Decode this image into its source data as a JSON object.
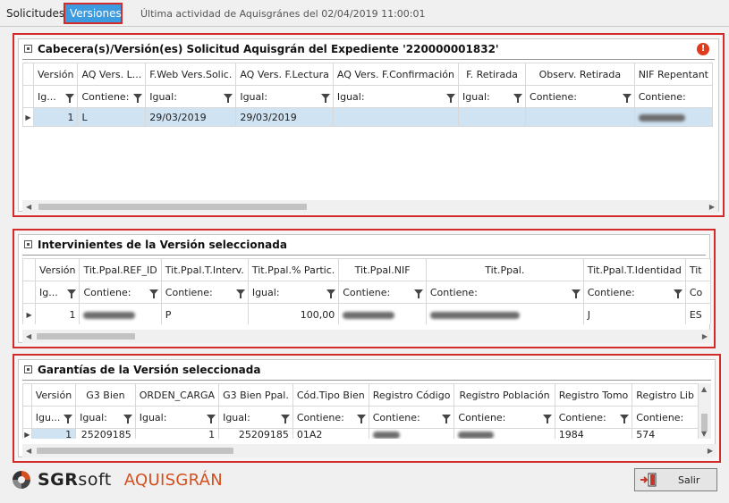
{
  "tabs": {
    "solicitudes": "Solicitudes",
    "versiones": "Versiones"
  },
  "last_activity": "Última actividad de Aquisgránes del 02/04/2019 11:00:01",
  "panel1": {
    "title": "Cabecera(s)/Versión(es) Solicitud Aquisgrán del Expediente '220000001832'",
    "columns": [
      "Versión",
      "AQ Vers. L...",
      "F.Web Vers.Solic.",
      "AQ Vers. F.Lectura",
      "AQ Vers. F.Confirmación",
      "F. Retirada",
      "Observ. Retirada",
      "NIF Repentant"
    ],
    "filters": [
      "Ig...",
      "Contiene:",
      "Igual:",
      "Igual:",
      "Igual:",
      "Igual:",
      "Contiene:",
      "Contiene:"
    ],
    "row": [
      "1",
      "L",
      "29/03/2019",
      "29/03/2019",
      "",
      "",
      "",
      ""
    ]
  },
  "panel2": {
    "title": "Intervinientes de la Versión seleccionada",
    "columns": [
      "Versión",
      "Tit.Ppal.REF_ID",
      "Tit.Ppal.T.Interv.",
      "Tit.Ppal.% Partic.",
      "Tit.Ppal.NIF",
      "Tit.Ppal.",
      "Tit.Ppal.T.Identidad",
      "Tit"
    ],
    "filters": [
      "Ig...",
      "Contiene:",
      "Contiene:",
      "Igual:",
      "Contiene:",
      "Contiene:",
      "Contiene:",
      "Co"
    ],
    "row": [
      "1",
      "",
      "P",
      "100,00",
      "",
      "",
      "J",
      "ES"
    ]
  },
  "panel3": {
    "title": "Garantías de la Versión seleccionada",
    "columns": [
      "Versión",
      "G3 Bien",
      "ORDEN_CARGA",
      "G3 Bien Ppal.",
      "Cód.Tipo Bien",
      "Registro Código",
      "Registro Población",
      "Registro Tomo",
      "Registro Lib"
    ],
    "filters": [
      "Igu...",
      "Igual:",
      "Igual:",
      "Igual:",
      "Contiene:",
      "Contiene:",
      "Contiene:",
      "Contiene:",
      "Contiene:"
    ],
    "row": [
      "1",
      "25209185",
      "1",
      "25209185",
      "01A2",
      "",
      "",
      "1984",
      "574"
    ]
  },
  "footer": {
    "brand_sgr": "SGR",
    "brand_soft": "soft",
    "brand_aq": "AQUISGRÁN",
    "exit_label": "Salir"
  }
}
